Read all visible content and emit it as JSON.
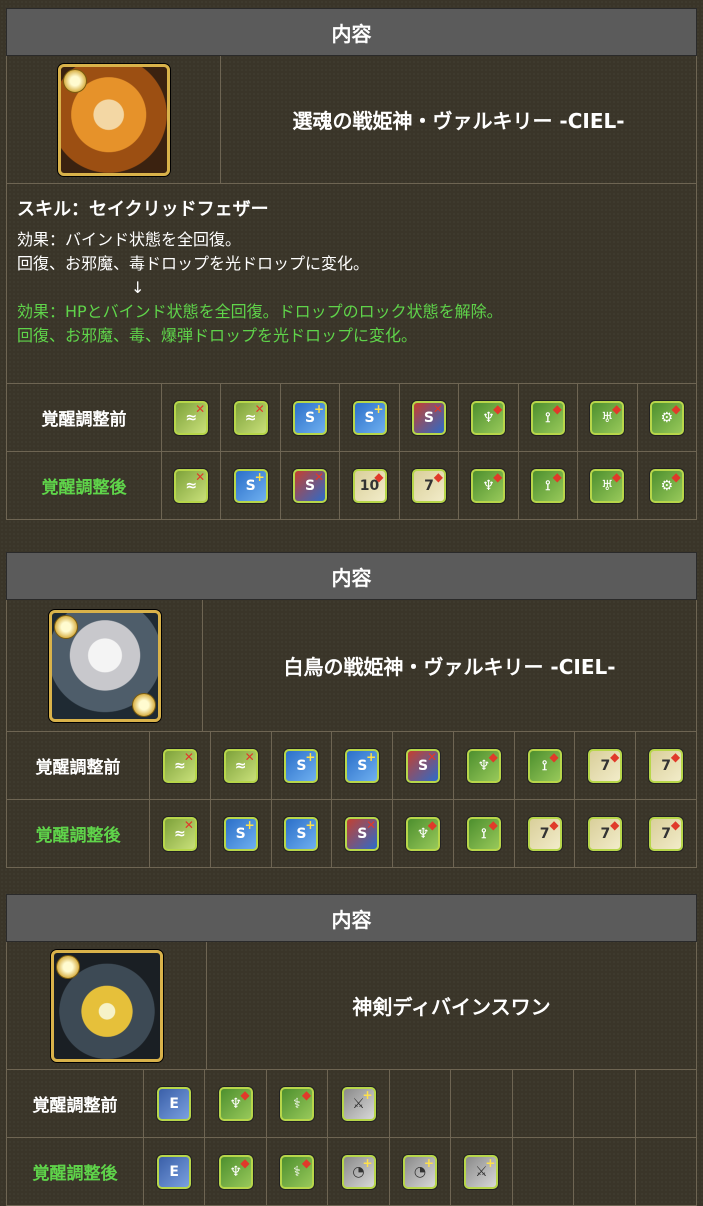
{
  "colors": {
    "accent_green": "#5fd44a",
    "header_bg": "#5b5b5b",
    "frame_gold": "#d9b24a"
  },
  "sections": [
    {
      "header": "内容",
      "monster_name": "選魂の戦姫神・ヴァルキリー -CIEL-",
      "portrait_icon": "valkyrie-ciel-orange-portrait",
      "skill": {
        "title": "スキル：セイクリッドフェザー",
        "before_line1": "効果：バインド状態を全回復。",
        "before_line2": "回復、お邪魔、毒ドロップを光ドロップに変化。",
        "arrow": "↓",
        "after_line1": "効果：HPとバインド状態を全回復。ドロップのロック状態を解除。",
        "after_line2": "回復、お邪魔、毒、爆弾ドロップを光ドロップに変化。"
      },
      "before_label": "覚醒調整前",
      "after_label": "覚醒調整後",
      "before_awakenings": [
        "bind-resist-x",
        "bind-resist-x",
        "skill-boost-plus",
        "skill-boost-plus",
        "skill-boost-x",
        "god-killer",
        "dragon-killer",
        "devil-killer",
        "machine-killer"
      ],
      "after_awakenings": [
        "bind-resist-xplus",
        "skill-boost-plus",
        "skill-boost-x",
        "ten-combo",
        "seven-combo",
        "god-killer",
        "dragon-killer",
        "devil-killer",
        "machine-killer"
      ]
    },
    {
      "header": "内容",
      "monster_name": "白鳥の戦姫神・ヴァルキリー -CIEL-",
      "portrait_icon": "valkyrie-ciel-white-portrait",
      "before_label": "覚醒調整前",
      "after_label": "覚醒調整後",
      "before_awakenings": [
        "bind-resist-x",
        "bind-resist-x",
        "skill-boost-plus",
        "skill-boost-plus",
        "skill-boost-x",
        "god-killer",
        "dragon-killer",
        "seven-combo",
        "seven-combo"
      ],
      "after_awakenings": [
        "bind-resist-xplus",
        "skill-boost-plus",
        "skill-boost-plus",
        "skill-boost-x",
        "god-killer",
        "dragon-killer",
        "seven-combo",
        "seven-combo",
        "seven-combo"
      ]
    },
    {
      "header": "内容",
      "monster_name": "神剣ディバインスワン",
      "portrait_icon": "divine-swan-sword-portrait",
      "before_label": "覚醒調整前",
      "after_label": "覚醒調整後",
      "before_awakenings": [
        "enhanced-e",
        "god-killer",
        "healer-killer",
        "auto-recover",
        "",
        "",
        "",
        "",
        ""
      ],
      "after_awakenings": [
        "enhanced-e",
        "god-killer",
        "healer-killer",
        "team-hp-plus",
        "team-hp-plus",
        "auto-recover",
        "",
        "",
        ""
      ]
    }
  ],
  "glyphs": {
    "bind-resist-x": {
      "glyph": "≈",
      "mark": "✕",
      "cls": "t-bind"
    },
    "bind-resist-xplus": {
      "glyph": "≈",
      "mark": "✕",
      "cls": "t-bind"
    },
    "skill-boost-plus": {
      "glyph": "S",
      "mark": "+",
      "cls": "t-skill"
    },
    "skill-boost-x": {
      "glyph": "S",
      "mark": "✕",
      "cls": "t-skillred"
    },
    "god-killer": {
      "glyph": "♆",
      "mark": "◆",
      "cls": "t-green"
    },
    "dragon-killer": {
      "glyph": "⟟",
      "mark": "◆",
      "cls": "t-green"
    },
    "devil-killer": {
      "glyph": "♅",
      "mark": "◆",
      "cls": "t-green"
    },
    "machine-killer": {
      "glyph": "⚙",
      "mark": "◆",
      "cls": "t-green"
    },
    "ten-combo": {
      "glyph": "10",
      "mark": "◆",
      "cls": "t-combo"
    },
    "seven-combo": {
      "glyph": "7",
      "mark": "◆",
      "cls": "t-combo"
    },
    "enhanced-e": {
      "glyph": "E",
      "mark": "",
      "cls": "t-blue"
    },
    "healer-killer": {
      "glyph": "⚕",
      "mark": "◆",
      "cls": "t-green"
    },
    "auto-recover": {
      "glyph": "⚔",
      "mark": "+",
      "cls": "t-silver"
    },
    "team-hp-plus": {
      "glyph": "◔",
      "mark": "+",
      "cls": "t-silver"
    }
  }
}
